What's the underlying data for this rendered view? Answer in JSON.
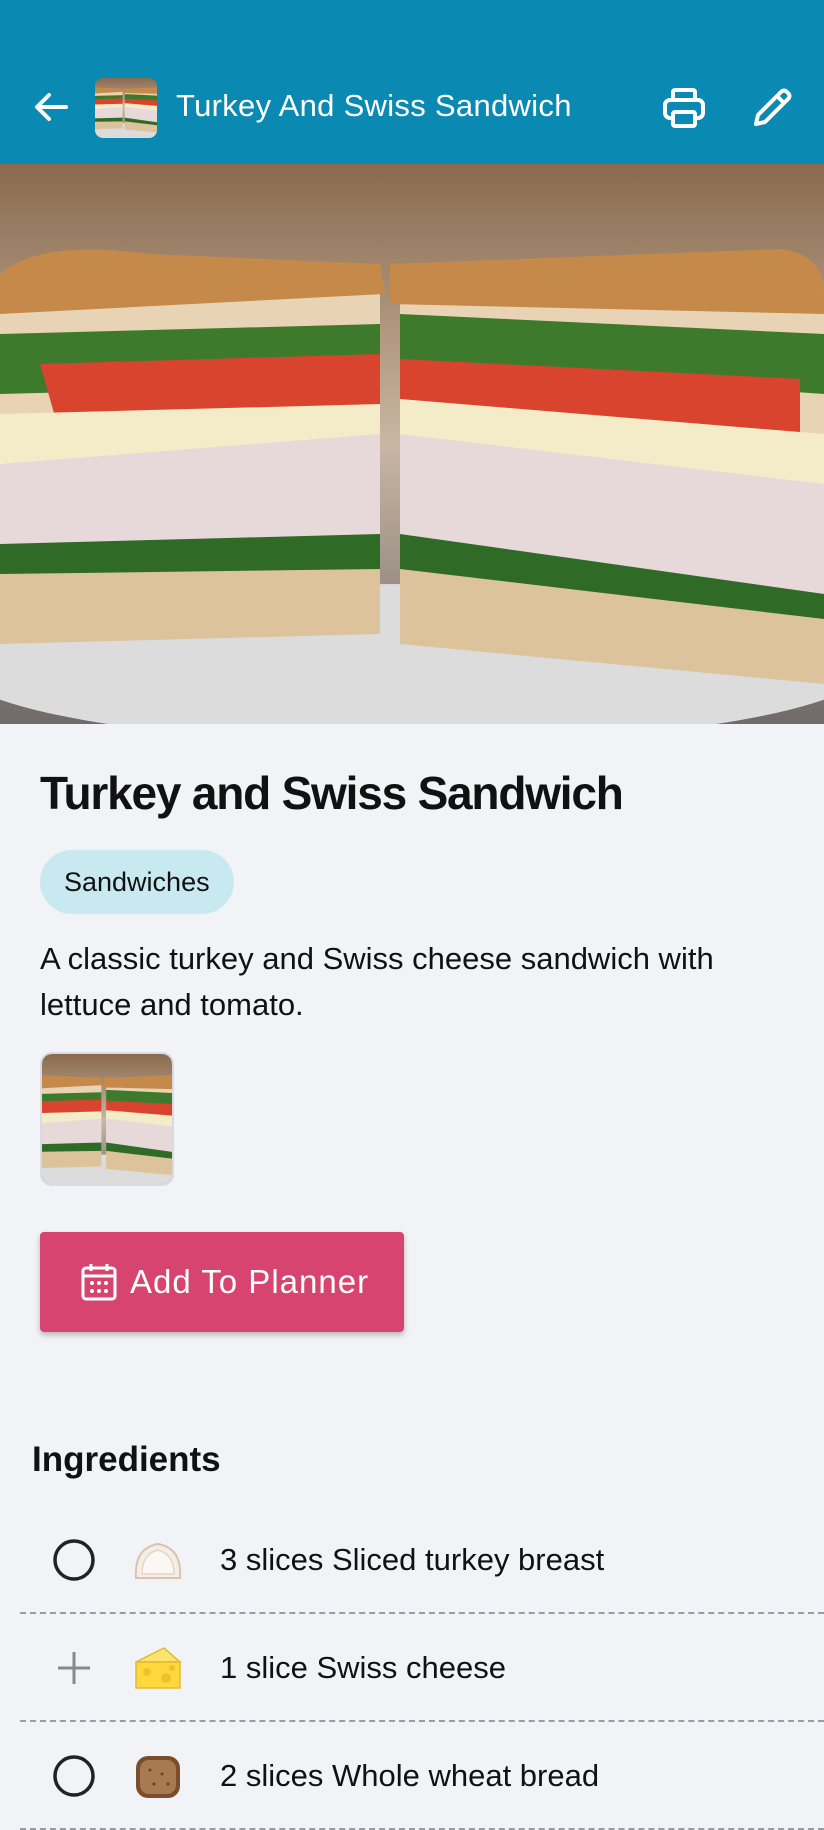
{
  "appbar": {
    "title": "Turkey And Swiss Sandwich",
    "icons": [
      "back-arrow-icon",
      "print-icon",
      "edit-pencil-icon"
    ]
  },
  "recipe": {
    "title": "Turkey and Swiss Sandwich",
    "category": "Sandwiches",
    "description": "A classic turkey and Swiss cheese sandwich with lettuce and tomato."
  },
  "planner_button": {
    "label": "Add To Planner",
    "icon": "calendar-icon",
    "color": "#d84470"
  },
  "ingredients": {
    "heading": "Ingredients",
    "items": [
      {
        "text": "3 slices Sliced turkey breast",
        "control": "radio",
        "icon": "turkey-slice-icon"
      },
      {
        "text": "1 slice Swiss cheese",
        "control": "plus",
        "icon": "cheese-icon"
      },
      {
        "text": "2 slices Whole wheat bread",
        "control": "radio",
        "icon": "bread-icon"
      }
    ]
  },
  "colors": {
    "appbar": "#0a8ab2",
    "chip": "#c9e9f1",
    "background": "#f2f3f7"
  }
}
